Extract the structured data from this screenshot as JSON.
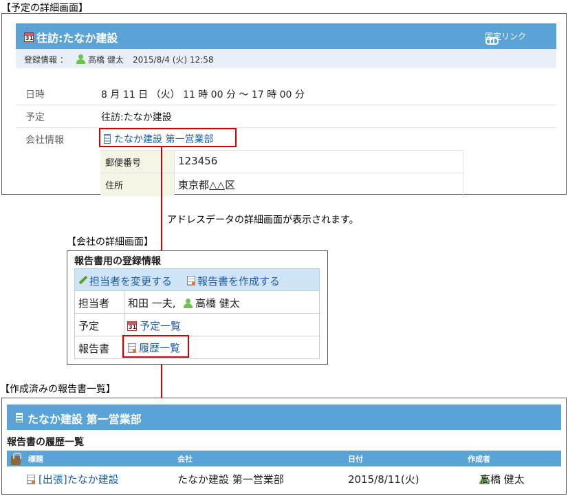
{
  "captions": {
    "schedule_detail": "【予定の詳細画面】",
    "address_note": "アドレスデータの詳細画面が表示されます。",
    "company_detail": "【会社の詳細画面】",
    "report_list": "【作成済みの報告書一覧】"
  },
  "schedule": {
    "title": "往訪:たなか建設",
    "permalink": "固定リンク",
    "reg_label": "登録情報 ：",
    "reg_user": "高橋 健太",
    "reg_date": "2015/8/4 (火) 12:58",
    "rows": [
      {
        "label": "日時",
        "value": "8 月 11 日 （火） 11 時 00 分 ～ 17 時 00 分"
      },
      {
        "label": "予定",
        "value": "往訪:たなか建設"
      },
      {
        "label": "会社情報",
        "value": "たなか建設 第一営業部"
      }
    ],
    "company_sub": [
      {
        "label": "郵便番号",
        "value": "123456"
      },
      {
        "label": "住所",
        "value": "東京都△△区"
      }
    ]
  },
  "company": {
    "heading": "報告書用の登録情報",
    "change_person": "担当者を変更する",
    "create_report": "報告書を作成する",
    "rows": [
      {
        "label": "担当者",
        "value_a": "和田 一夫,",
        "value_b": "高橋 健太"
      },
      {
        "label": "予定",
        "value": "予定一覧"
      },
      {
        "label": "報告書",
        "value": "履歴一覧"
      }
    ]
  },
  "reports": {
    "title": "たなか建設 第一営業部",
    "subheading": "報告書の履歴一覧",
    "columns": [
      "標題",
      "会社",
      "日付",
      "作成者"
    ],
    "rows": [
      {
        "title": "[出張]たなか建設",
        "company": "たなか建設 第一営業部",
        "date": "2015/8/11(火)",
        "author": "高橋 健太"
      }
    ]
  },
  "colors": {
    "accent": "#5aa3d6",
    "highlight": "#d40000",
    "link": "#1a5da8"
  }
}
